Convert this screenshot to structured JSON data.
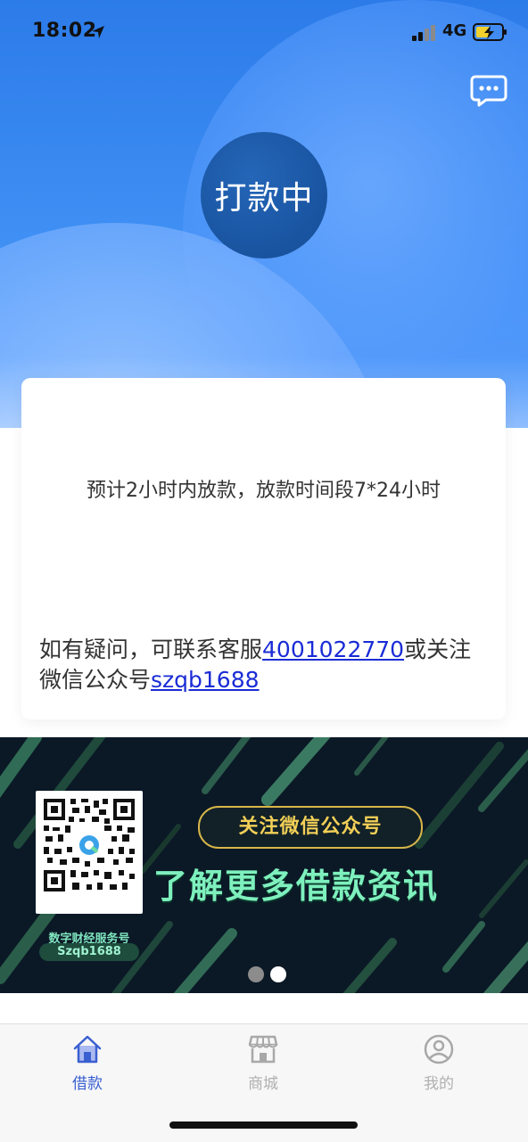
{
  "status_bar": {
    "time": "18:02",
    "network": "4G"
  },
  "header": {
    "status_text": "打款中"
  },
  "card": {
    "estimate_text": "预计2小时内放款，放款时间段7*24小时",
    "contact_prefix": "如有疑问，可联系客服",
    "phone": "4001022770",
    "contact_middle": "或关注微信公众号",
    "wechat_id": "szqb1688"
  },
  "banner": {
    "pill_text": "关注微信公众号",
    "headline": "了解更多借款资讯",
    "qr_caption_title": "数字财经服务号",
    "qr_caption_id": "Szqb1688",
    "slide_count": 2,
    "active_slide": 2
  },
  "tabs": [
    {
      "label": "借款",
      "icon": "home-icon",
      "active": true
    },
    {
      "label": "商城",
      "icon": "store-icon",
      "active": false
    },
    {
      "label": "我的",
      "icon": "user-icon",
      "active": false
    }
  ],
  "colors": {
    "primary_blue": "#2c7be9",
    "status_circle": "#1a56a3",
    "link": "#1a2cd6",
    "tab_active": "#3a5fd1",
    "tab_inactive": "#b0b0b0",
    "banner_bg": "#0b1926",
    "banner_green": "#7ef0bd",
    "banner_gold": "#f2cf57"
  }
}
